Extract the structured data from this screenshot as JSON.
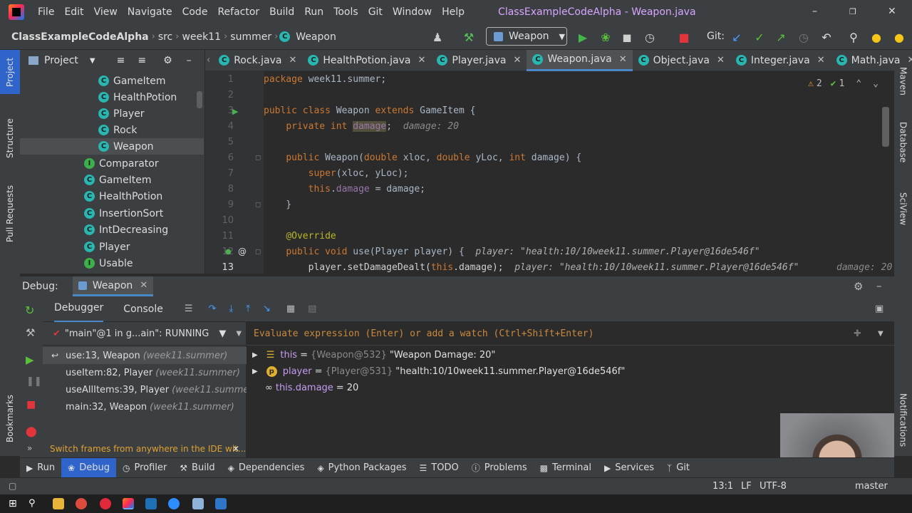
{
  "window": {
    "title": "ClassExampleCodeAlpha - Weapon.java",
    "menu": [
      "File",
      "Edit",
      "View",
      "Navigate",
      "Code",
      "Refactor",
      "Build",
      "Run",
      "Tools",
      "Git",
      "Window",
      "Help"
    ]
  },
  "breadcrumb": [
    "ClassExampleCodeAlpha",
    "src",
    "week11",
    "summer",
    "Weapon"
  ],
  "toolbar": {
    "run_config": "Weapon",
    "git_label": "Git:"
  },
  "left_strip": [
    "Project",
    "Structure",
    "Pull Requests",
    "Bookmarks"
  ],
  "right_strip": [
    "Maven",
    "Database",
    "SciView",
    "Notifications"
  ],
  "project": {
    "title": "Project",
    "items": [
      {
        "label": "GameItem",
        "icon": "class-icon"
      },
      {
        "label": "HealthPotion",
        "icon": "class-icon"
      },
      {
        "label": "Player",
        "icon": "class-icon"
      },
      {
        "label": "Rock",
        "icon": "class-icon"
      },
      {
        "label": "Weapon",
        "icon": "class-icon"
      },
      {
        "label": "Comparator",
        "icon": "interface-icon"
      },
      {
        "label": "GameItem",
        "icon": "class-icon"
      },
      {
        "label": "HealthPotion",
        "icon": "class-icon"
      },
      {
        "label": "InsertionSort",
        "icon": "class-icon"
      },
      {
        "label": "IntDecreasing",
        "icon": "class-icon"
      },
      {
        "label": "Player",
        "icon": "class-icon"
      },
      {
        "label": "Usable",
        "icon": "interface-icon"
      }
    ]
  },
  "tabs": [
    "Rock.java",
    "HealthPotion.java",
    "Player.java",
    "Weapon.java",
    "Object.java",
    "Integer.java",
    "Math.java"
  ],
  "editor": {
    "inspections": {
      "warnings": "2",
      "ok": "1"
    },
    "line_numbers": [
      "1",
      "2",
      "3",
      "4",
      "5",
      "6",
      "7",
      "8",
      "9",
      "10",
      "11",
      "12",
      "13"
    ],
    "hints": {
      "l4": "damage: 20",
      "l12": "player: \"health:10/10week11.summer.Player@16de546f\"",
      "l13": "player: \"health:10/10week11.summer.Player@16de546f\"",
      "l13_right": "damage: 20"
    }
  },
  "debug": {
    "label": "Debug:",
    "config": "Weapon",
    "tabs": [
      "Debugger",
      "Console"
    ],
    "thread": "\"main\"@1 in g...ain\": RUNNING",
    "eval_placeholder": "Evaluate expression (Enter) or add a watch (Ctrl+Shift+Enter)",
    "frames": [
      {
        "method": "use:13, Weapon",
        "pkg": "(week11.summer)"
      },
      {
        "method": "useItem:82, Player",
        "pkg": "(week11.summer)"
      },
      {
        "method": "useAllItems:39, Player",
        "pkg": "(week11.summer)"
      },
      {
        "method": "main:32, Weapon",
        "pkg": "(week11.summer)"
      }
    ],
    "frames_tip": "Switch frames from anywhere in the IDE wit...",
    "variables": [
      {
        "name": "this",
        "type": "{Weapon@532}",
        "value": "\"Weapon Damage: 20\""
      },
      {
        "name": "player",
        "type": "{Player@531}",
        "value": "\"health:10/10week11.summer.Player@16de546f\""
      },
      {
        "name": "this.damage",
        "type": "",
        "value": "20"
      }
    ]
  },
  "tool_tabs": [
    "Run",
    "Debug",
    "Profiler",
    "Build",
    "Dependencies",
    "Python Packages",
    "TODO",
    "Problems",
    "Terminal",
    "Services",
    "Git"
  ],
  "status": {
    "position": "13:1",
    "line_sep": "LF",
    "encoding": "UTF-8",
    "branch": "master"
  }
}
